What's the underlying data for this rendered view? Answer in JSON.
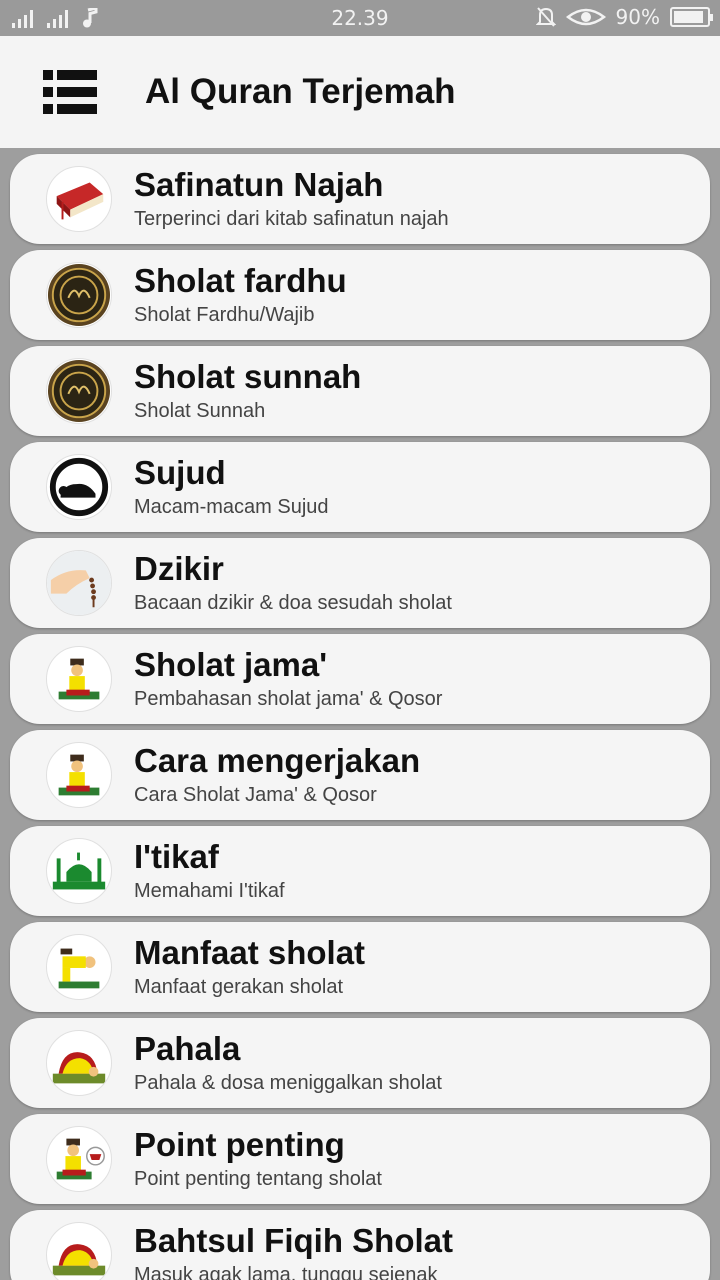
{
  "status_bar": {
    "time": "22.39",
    "battery": "90%",
    "icons": [
      "signal-icon",
      "signal-icon",
      "music-note-icon",
      "bell-off-icon",
      "eye-icon",
      "battery-icon"
    ]
  },
  "app_bar": {
    "title": "Al Quran Terjemah",
    "menu_icon": "menu-list-icon"
  },
  "items": [
    {
      "title": "Safinatun Najah",
      "subtitle": "Terperinci dari kitab safinatun najah",
      "icon": "red-book-icon"
    },
    {
      "title": "Sholat fardhu",
      "subtitle": "Sholat Fardhu/Wajib",
      "icon": "quran-cover-icon"
    },
    {
      "title": "Sholat sunnah",
      "subtitle": "Sholat Sunnah",
      "icon": "quran-cover-icon"
    },
    {
      "title": "Sujud",
      "subtitle": "Macam-macam Sujud",
      "icon": "sujud-icon"
    },
    {
      "title": "Dzikir",
      "subtitle": "Bacaan dzikir & doa sesudah sholat",
      "icon": "prayer-beads-icon"
    },
    {
      "title": "Sholat jama'",
      "subtitle": "Pembahasan sholat jama' & Qosor",
      "icon": "praying-man-icon"
    },
    {
      "title": "Cara mengerjakan",
      "subtitle": "Cara Sholat Jama' & Qosor",
      "icon": "praying-man-icon"
    },
    {
      "title": "I'tikaf",
      "subtitle": "Memahami I'tikaf",
      "icon": "mosque-icon"
    },
    {
      "title": "Manfaat sholat",
      "subtitle": "Manfaat gerakan sholat",
      "icon": "bowing-man-icon"
    },
    {
      "title": "Pahala",
      "subtitle": "Pahala & dosa meniggalkan sholat",
      "icon": "prostrating-man-icon"
    },
    {
      "title": "Point penting",
      "subtitle": "Point penting tentang sholat",
      "icon": "praying-man-icon"
    },
    {
      "title": "Bahtsul Fiqih Sholat",
      "subtitle": "Masuk agak lama, tunggu sejenak",
      "icon": "prostrating-man-icon"
    }
  ]
}
